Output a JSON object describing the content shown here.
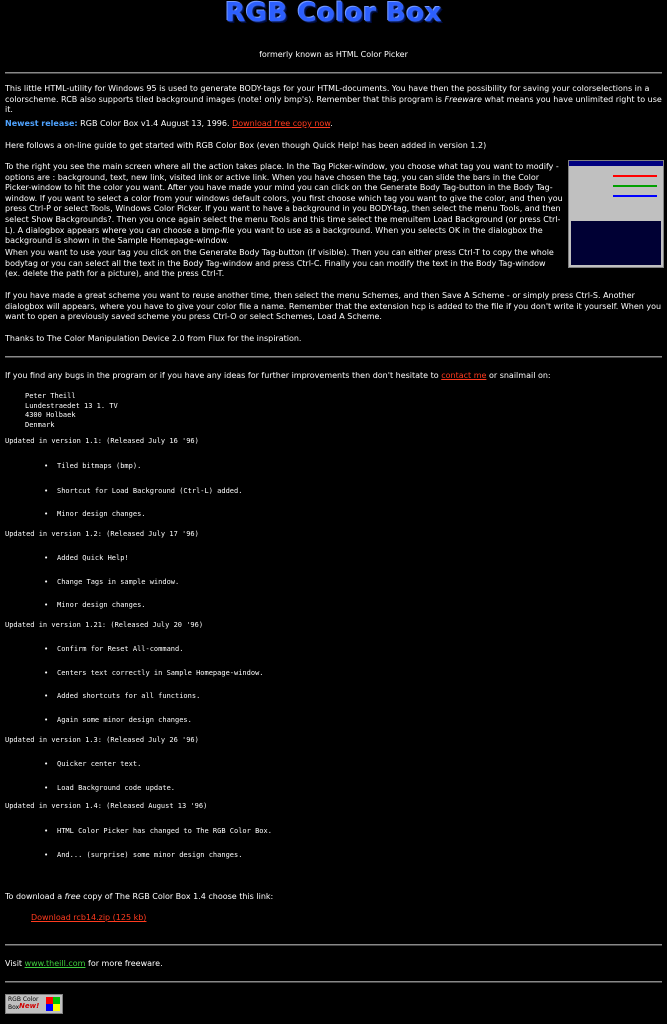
{
  "header": {
    "title": "RGB Color Box",
    "subtitle": "formerly known as HTML Color Picker"
  },
  "intro": {
    "text1": "This little HTML-utility for Windows 95 is used to generate BODY-tags for your HTML-documents. You have then the possibility for saving your colorselections in a colorscheme. RCB also supports tiled background images (note! only bmp's). Remember that this program is ",
    "freeware": "Freeware",
    "text2": " what means you have unlimited right to use it."
  },
  "release": {
    "label": "Newest release:",
    "text": " RGB Color Box v1.4 August 13, 1996. ",
    "link": "Download free copy now",
    "after": "."
  },
  "guide": {
    "intro": "Here follows a on-line guide to get started with RGB Color Box (even though Quick Help! has been added in version 1.2)",
    "para1": "To the right you see the main screen where all the action takes place. In the Tag Picker-window, you choose what tag you want to modify - options are : background, text, new link, visited link or active link. When you have chosen the tag, you can slide the bars in the Color Picker-window to hit the color you want. After you have made your mind you can click on the Generate Body Tag-button in the Body Tag-window. If you want to select a color from your windows default colors, you first choose which tag you want to give the color, and then you press Ctrl-P or select Tools, Windows Color Picker. If you want to have a background in you BODY-tag, then select the menu Tools, and then select Show Backgrounds?. Then you once again select the menu Tools and this time select the menuitem Load Background (or press Ctrl-L). A dialogbox appears where you can choose a bmp-file you want to use as a background. When you selects OK in the dialogbox the background is shown in the Sample Homepage-window.",
    "para2": "When you want to use your tag you click on the Generate Body Tag-button (if visible). Then you can either press Ctrl-T to copy the whole bodytag or you can select all the text in the Body Tag-window and press Ctrl-C. Finally you can modify the text in the Body Tag-window (ex. delete the path for a picture), and the press Ctrl-T.",
    "para3": "If you have made a great scheme you want to reuse another time, then select the menu Schemes, and then Save A Scheme - or simply press Ctrl-S. Another dialogbox will appears, where you have to give your color file a name. Remember that the extension hcp is added to the file if you don't write it yourself. When you want to open a previously saved scheme you press Ctrl-O or select Schemes, Load A Scheme.",
    "para4": "Thanks to The Color Manipulation Device 2.0 from Flux for the inspiration."
  },
  "contact": {
    "text1": "If you find any bugs in the program or if you have any ideas for further improvements then don't hesitate to ",
    "link": "contact me",
    "text2": " or snailmail on:",
    "address": [
      "Peter Theill",
      "Lundestraedet 13 1. TV",
      "4300 Holbaek",
      "Denmark"
    ]
  },
  "versions": [
    {
      "heading": "Updated in version 1.1: (Released July 16 '96)",
      "items": [
        "Tiled bitmaps (bmp).",
        "Shortcut for Load Background (Ctrl-L) added.",
        "Minor design changes."
      ]
    },
    {
      "heading": "Updated in version 1.2: (Released July 17 '96)",
      "items": [
        "Added Quick Help!",
        "Change Tags in sample window.",
        "Minor design changes."
      ]
    },
    {
      "heading": "Updated in version 1.21: (Released July 20 '96)",
      "items": [
        "Confirm for Reset All-command.",
        "Centers text correctly in Sample Homepage-window.",
        "Added shortcuts for all functions.",
        "Again some minor design changes."
      ]
    },
    {
      "heading": "Updated in version 1.3: (Released July 26 '96)",
      "items": [
        "Quicker center text.",
        "Load Background code update."
      ]
    },
    {
      "heading": "Updated in version 1.4: (Released August 13 '96)",
      "items": [
        "HTML Color Picker has changed to The RGB Color Box.",
        "And... (surprise) some minor design changes."
      ]
    }
  ],
  "download": {
    "text1": "To download a ",
    "free": "free",
    "text2": " copy of The RGB Color Box 1.4 choose this link:",
    "link": "Download rcb14.zip (125 kb)"
  },
  "footer": {
    "text1": "Visit ",
    "link": "www.theill.com",
    "text2": " for more freeware.",
    "badge_line1": "RGB Color",
    "badge_line2": "Box",
    "badge_new": "New!"
  },
  "colors": {
    "background": "#000000",
    "text": "#ffffff",
    "link": "#ff3b1f",
    "accent": "#4fa3ff",
    "visit_link": "#3ecf3e"
  }
}
